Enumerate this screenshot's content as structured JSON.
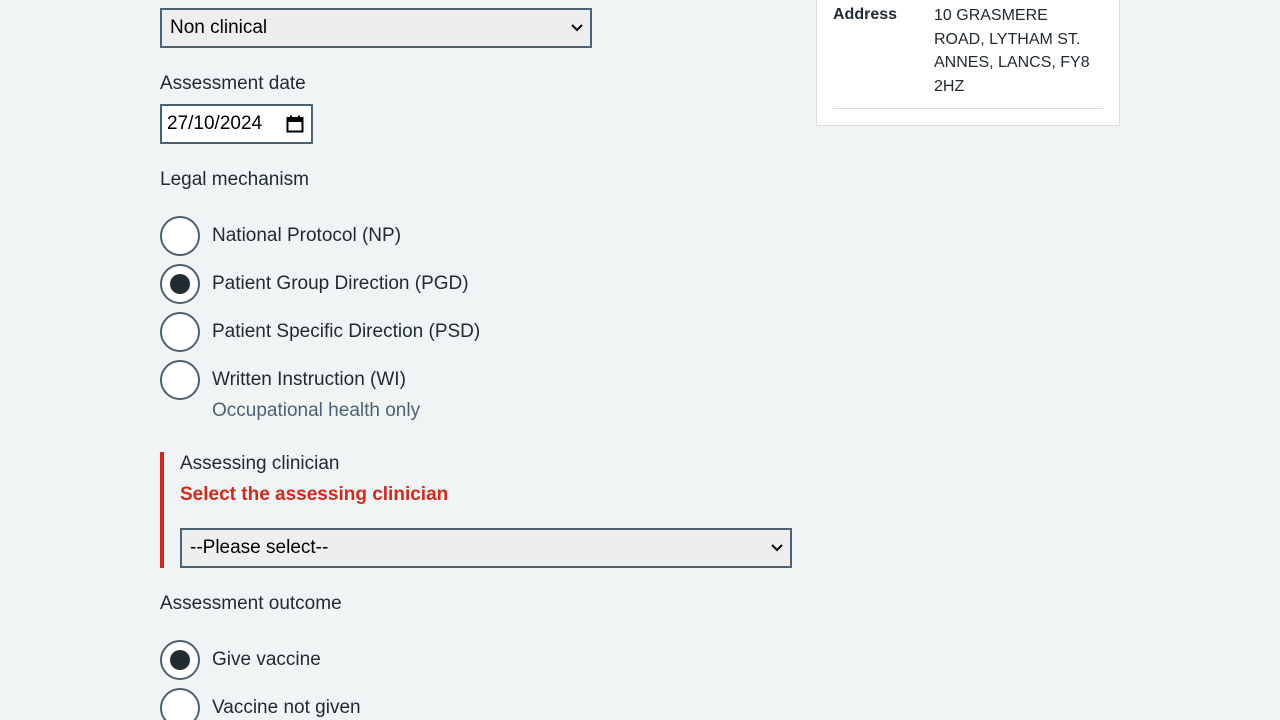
{
  "vaccine_type_select": {
    "value": "Non clinical"
  },
  "assessment_date": {
    "label": "Assessment date",
    "value": "27/10/2024"
  },
  "legal_mechanism": {
    "label": "Legal mechanism",
    "options": [
      {
        "label": "National Protocol (NP)",
        "selected": false
      },
      {
        "label": "Patient Group Direction (PGD)",
        "selected": true
      },
      {
        "label": "Patient Specific Direction (PSD)",
        "selected": false
      },
      {
        "label": "Written Instruction (WI)",
        "selected": false,
        "hint": "Occupational health only"
      }
    ]
  },
  "assessing_clinician": {
    "label": "Assessing clinician",
    "error": "Select the assessing clinician",
    "value": "--Please select--"
  },
  "assessment_outcome": {
    "label": "Assessment outcome",
    "options": [
      {
        "label": "Give vaccine",
        "selected": true
      },
      {
        "label": "Vaccine not given",
        "selected": false
      }
    ]
  },
  "summary": {
    "address_key": "Address",
    "address_value": "10 GRASMERE ROAD, LYTHAM ST. ANNES, LANCS, FY8 2HZ"
  },
  "colors": {
    "error": "#d5281b",
    "border": "#4c6272",
    "text": "#212b32",
    "background": "#f0f4f5"
  }
}
